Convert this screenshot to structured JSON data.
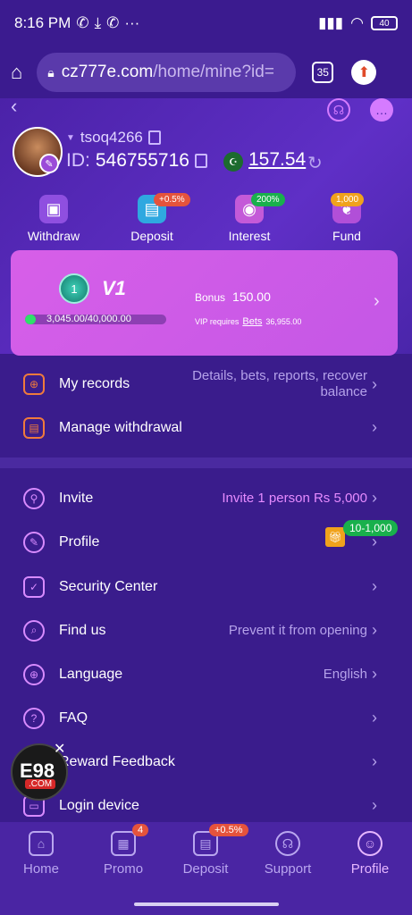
{
  "status": {
    "time": "8:16 PM",
    "battery": "40"
  },
  "browser": {
    "url_host": "cz777e.com",
    "url_path": "/home/mine?id=",
    "tab_count": "35"
  },
  "user": {
    "username": "tsoq4266",
    "id_label": "ID:",
    "id": "546755716",
    "balance": "157.54"
  },
  "quick_actions": [
    {
      "label": "Withdraw",
      "badge": ""
    },
    {
      "label": "Deposit",
      "badge": "+0.5%"
    },
    {
      "label": "Interest",
      "badge": "200%"
    },
    {
      "label": "Fund",
      "badge": "1,000"
    }
  ],
  "vip": {
    "badge_number": "1",
    "level": "V1",
    "progress_text": "3,045.00/40,000.00",
    "progress_fraction": 0.076,
    "bonus_label": "Bonus",
    "bonus_value": "150.00",
    "requires_text": "VIP requires",
    "bets_label": "Bets",
    "bets_value": "36,955.00"
  },
  "section1": [
    {
      "label": "My records",
      "hint": "Details, bets, reports, recover balance"
    },
    {
      "label": "Manage withdrawal",
      "hint": ""
    }
  ],
  "section2": [
    {
      "label": "Invite",
      "hint": "Invite 1 person Rs 5,000"
    },
    {
      "label": "Profile",
      "hint": ""
    },
    {
      "label": "Security Center",
      "hint": ""
    },
    {
      "label": "Find us",
      "hint": "Prevent it from opening"
    },
    {
      "label": "Language",
      "hint": "English"
    },
    {
      "label": "FAQ",
      "hint": ""
    },
    {
      "label": "Reward Feedback",
      "hint": ""
    },
    {
      "label": "Login device",
      "hint": ""
    }
  ],
  "profile_gift_badge": "10-1,000",
  "floating_logo": {
    "text": "E98",
    "sub": ".COM"
  },
  "nav": [
    {
      "label": "Home",
      "badge": ""
    },
    {
      "label": "Promo",
      "badge": "4"
    },
    {
      "label": "Deposit",
      "badge": "+0.5%"
    },
    {
      "label": "Support",
      "badge": ""
    },
    {
      "label": "Profile",
      "badge": ""
    }
  ],
  "colors": {
    "background": "#3a1c8c",
    "vip_card": "#d75fe8",
    "accent_pink": "#e6b7ff",
    "badge_green": "#19b04c"
  }
}
